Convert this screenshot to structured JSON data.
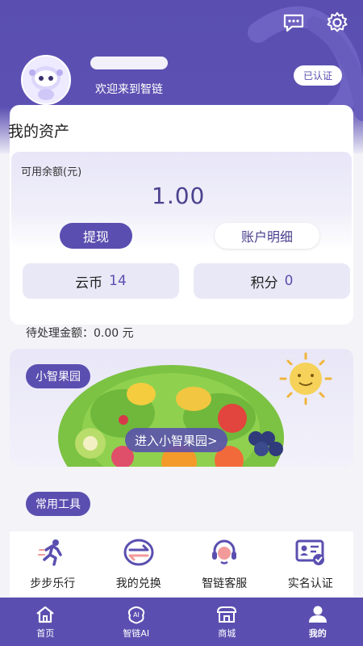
{
  "header": {
    "username": "********",
    "welcome": "欢迎来到智链",
    "verified_badge": "已认证",
    "icons": [
      "message-icon",
      "settings-icon"
    ]
  },
  "assets": {
    "title": "我的资产",
    "balance_label": "可用余额(元)",
    "balance_value": "1.00",
    "withdraw_label": "提现",
    "detail_label": "账户明细",
    "cloud_coin_label": "云币",
    "cloud_coin_value": "14",
    "points_label": "积分",
    "points_value": "0",
    "pending": "待处理金额：0.00 元"
  },
  "orchard": {
    "tag": "小智果园",
    "enter_label": "进入小智果园>"
  },
  "tools": {
    "section_label": "常用工具",
    "items": [
      {
        "label": "步步乐行",
        "icon": "running-icon"
      },
      {
        "label": "我的兑换",
        "icon": "exchange-icon"
      },
      {
        "label": "智链客服",
        "icon": "customer-service-icon"
      },
      {
        "label": "实名认证",
        "icon": "id-card-icon"
      }
    ]
  },
  "tabbar": {
    "items": [
      {
        "label": "首页",
        "icon": "home-icon"
      },
      {
        "label": "智链AI",
        "icon": "ai-icon"
      },
      {
        "label": "商城",
        "icon": "shop-icon"
      },
      {
        "label": "我的",
        "icon": "profile-icon"
      }
    ],
    "active": "我的"
  },
  "colors": {
    "primary": "#5a4fb0",
    "accent_text": "#4b418f",
    "page_bg": "#f3f3f8"
  }
}
